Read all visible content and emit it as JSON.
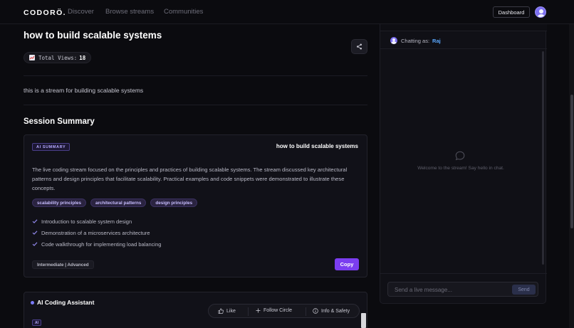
{
  "header": {
    "logo": "CODORÖ.",
    "nav": [
      "Discover",
      "Browse streams",
      "Communities"
    ],
    "dashboard_label": "Dashboard"
  },
  "stream": {
    "title": "how to build scalable systems",
    "views_label": "Total Views:",
    "views_count": "18",
    "description": "this is a stream for building scalable systems"
  },
  "summary": {
    "section_title": "Session Summary",
    "badge": "AI SUMMARY",
    "card_title": "how to build scalable systems",
    "text": "The live coding stream focused on the principles and practices of building scalable systems. The stream discussed key architectural patterns and design principles that facilitate scalability. Practical examples and code snippets were demonstrated to illustrate these concepts.",
    "tags": [
      "scalability principles",
      "architectural patterns",
      "design principles"
    ],
    "points": [
      "Introduction to scalable system design",
      "Demonstration of a microservices architecture",
      "Code walkthrough for implementing load balancing"
    ],
    "level": "Intermediate | Advanced",
    "copy_label": "Copy"
  },
  "assistant": {
    "title": "AI Coding Assistant",
    "badge": "AI"
  },
  "actions": {
    "like": "Like",
    "follow": "Follow Circle",
    "info": "Info & Safety"
  },
  "chat": {
    "chatting_as": "Chatting as:",
    "user": "Raj",
    "welcome": "Welcome to the stream! Say hello in chat.",
    "placeholder": "Send a live message...",
    "send_label": "Send"
  },
  "colors": {
    "background": "#0b0b0f",
    "accent": "#7b3df0",
    "tag_bg": "#2a2340",
    "username": "#5aa8ff"
  }
}
